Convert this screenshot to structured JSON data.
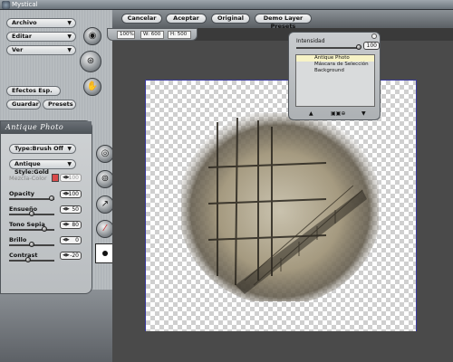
{
  "window": {
    "title": "Mystical"
  },
  "toolbar": {
    "cancel": "Cancelar",
    "accept": "Aceptar",
    "original": "Original",
    "demo_presets": "Demo Layer Presets"
  },
  "size": {
    "zoom": "100%",
    "width": "W: 600",
    "height": "H: 500"
  },
  "menu": {
    "archivo": "Archivo",
    "editar": "Editar",
    "ver": "Ver",
    "efectos": "Efectos Esp.",
    "guardar": "Guardar",
    "presets": "Presets"
  },
  "panel": {
    "title": "Antique Photo",
    "type_label": "Type:Brush Off",
    "style_label": "Antique Style:Gold",
    "params": [
      {
        "label": "Mezcla-Color",
        "value": "100",
        "dim": true,
        "level": 1.0
      },
      {
        "label": "Opacity",
        "value": "100",
        "dim": false,
        "level": 1.0
      },
      {
        "label": "Ensueño",
        "value": "50",
        "dim": false,
        "level": 0.5
      },
      {
        "label": "Tono Sepia",
        "value": "80",
        "dim": false,
        "level": 0.8
      },
      {
        "label": "Brillo",
        "value": "0",
        "dim": false,
        "level": 0.5
      },
      {
        "label": "Contrast",
        "value": "-20",
        "dim": false,
        "level": 0.4
      }
    ]
  },
  "layers": {
    "intensity_label": "Intensidad",
    "intensity_value": "100",
    "items": [
      "Antique Photo",
      "Máscara de Selección",
      "Background"
    ]
  },
  "colors": {
    "accent": "#d94a4a",
    "panel": "#c9cccf",
    "selection": "#f7f3c6"
  }
}
